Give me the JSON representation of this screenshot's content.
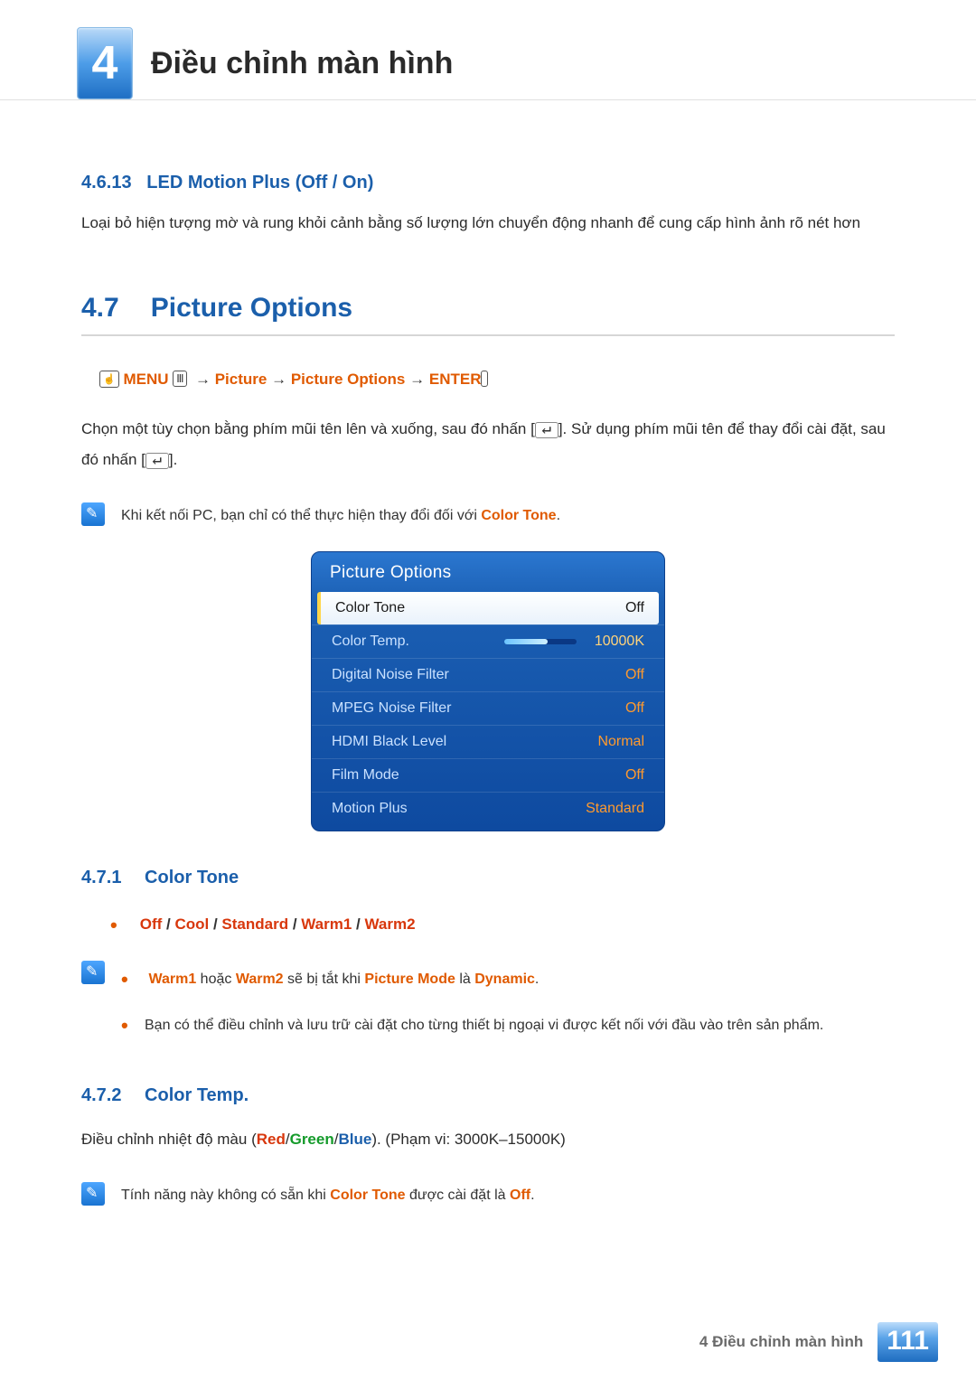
{
  "chapter": {
    "number": "4",
    "title": "Điều chỉnh màn hình"
  },
  "sec_4_6_13": {
    "number": "4.6.13",
    "title": "LED Motion Plus (Off / On)",
    "body": "Loại bỏ hiện tượng mờ và rung khỏi cảnh bằng số lượng lớn chuyển động nhanh để cung cấp hình ảnh rõ nét hơn"
  },
  "sec_4_7": {
    "number": "4.7",
    "title": "Picture Options",
    "menu_path": {
      "menu": "MENU",
      "picture": "Picture",
      "picture_options": "Picture Options",
      "enter": "ENTER",
      "arrow": "→"
    },
    "body1a": "Chọn một tùy chọn bằng phím mũi tên lên và xuống, sau đó nhấn [",
    "body1b": "]. Sử dụng phím mũi tên để thay đổi cài đặt, sau đó nhấn [",
    "body1c": "].",
    "pc_note_a": "Khi kết nối PC, bạn chỉ có thể thực hiện thay đổi đối với ",
    "pc_note_b": "Color Tone",
    "pc_note_c": "."
  },
  "osd": {
    "title": "Picture Options",
    "items": [
      {
        "label": "Color Tone",
        "value": "Off",
        "selected": true
      },
      {
        "label": "Color Temp.",
        "value": "10000K",
        "slider": true
      },
      {
        "label": "Digital Noise Filter",
        "value": "Off"
      },
      {
        "label": "MPEG Noise Filter",
        "value": "Off"
      },
      {
        "label": "HDMI Black Level",
        "value": "Normal"
      },
      {
        "label": "Film Mode",
        "value": "Off"
      },
      {
        "label": "Motion Plus",
        "value": "Standard"
      }
    ]
  },
  "sec_4_7_1": {
    "number": "4.7.1",
    "title": "Color Tone",
    "opts": [
      "Off",
      "Cool",
      "Standard",
      "Warm1",
      "Warm2"
    ],
    "sep": " / ",
    "note1": {
      "w1": "Warm1",
      "mid": " hoặc ",
      "w2": "Warm2",
      "mid2": " sẽ bị tắt khi ",
      "pm": "Picture Mode",
      "mid3": " là ",
      "dyn": "Dynamic",
      "dot": "."
    },
    "note2": "Bạn có thể điều chỉnh và lưu trữ cài đặt cho từng thiết bị ngoại vi được kết nối với đầu vào trên sản phẩm."
  },
  "sec_4_7_2": {
    "number": "4.7.2",
    "title": "Color Temp.",
    "body_a": "Điều chỉnh nhiệt độ màu (",
    "r": "Red",
    "slash": "/",
    "g": "Green",
    "b": "Blue",
    "body_b": "). (Phạm vi: 3000K–15000K)",
    "note_a": "Tính năng này không có sẵn khi ",
    "note_b": "Color Tone",
    "note_c": " được cài đặt là ",
    "note_d": "Off",
    "note_e": "."
  },
  "footer": {
    "text": "4 Điều chỉnh màn hình",
    "page": "111"
  }
}
